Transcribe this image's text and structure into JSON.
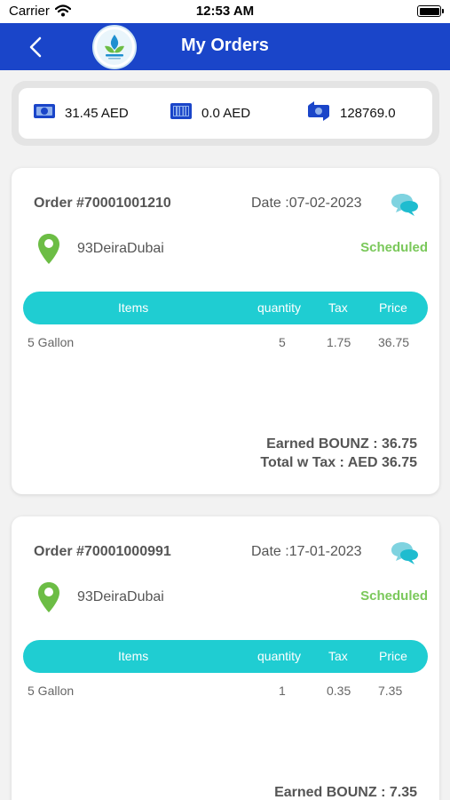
{
  "status_bar": {
    "carrier": "Carrier",
    "time": "12:53 AM"
  },
  "nav": {
    "title": "My Orders",
    "brand_color": "#1a45c9"
  },
  "wallet": [
    {
      "icon": "cash-icon",
      "value": "31.45 AED"
    },
    {
      "icon": "barcode-card-icon",
      "value": "0.0 AED"
    },
    {
      "icon": "points-exchange-icon",
      "value": "128769.0"
    }
  ],
  "table_headers": {
    "items": "Items",
    "quantity": "quantity",
    "tax": "Tax",
    "price": "Price"
  },
  "colors": {
    "accent": "#1fcdd2",
    "status": "#7ac85a",
    "pin": "#6cbd45"
  },
  "orders": [
    {
      "order_no": "Order #70001001210",
      "date": "Date :07-02-2023",
      "address": "93DeiraDubai",
      "status": "Scheduled",
      "rows": [
        {
          "name": "5 Gallon",
          "quantity": "5",
          "tax": "1.75",
          "price": "36.75"
        }
      ],
      "earned": "Earned BOUNZ : 36.75",
      "total": "Total w Tax : AED 36.75"
    },
    {
      "order_no": "Order #70001000991",
      "date": "Date :17-01-2023",
      "address": "93DeiraDubai",
      "status": "Scheduled",
      "rows": [
        {
          "name": "5 Gallon",
          "quantity": "1",
          "tax": "0.35",
          "price": "7.35"
        }
      ],
      "earned": "Earned BOUNZ : 7.35"
    }
  ]
}
